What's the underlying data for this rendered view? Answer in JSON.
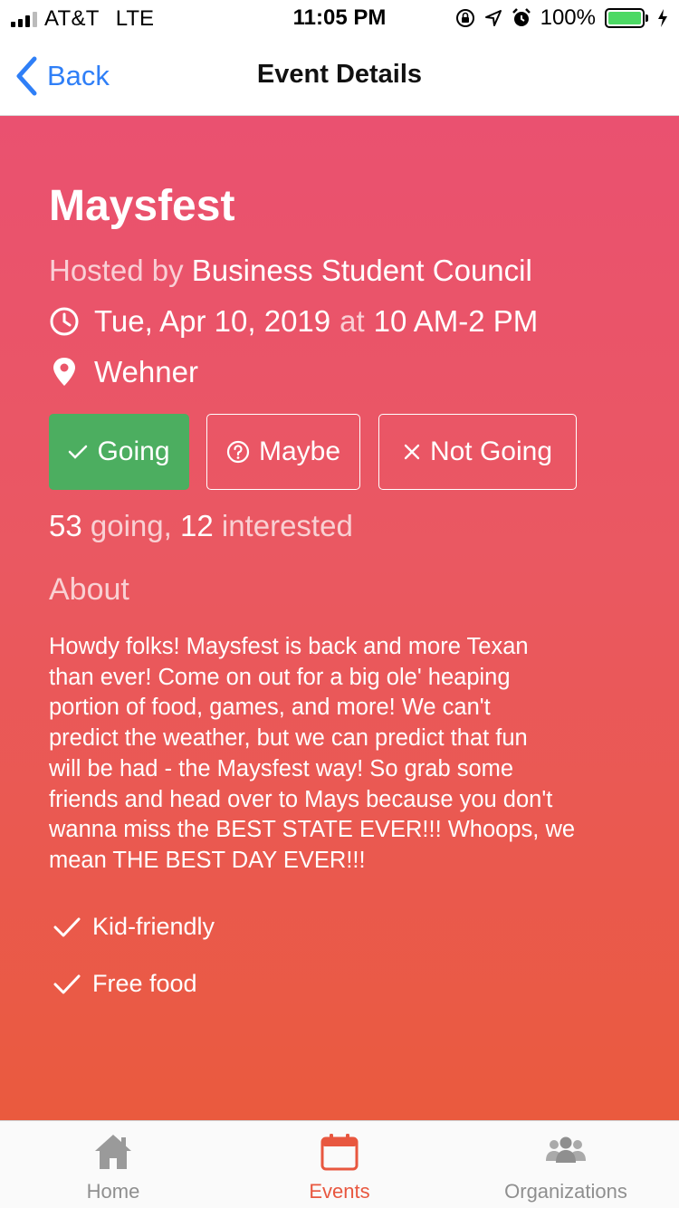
{
  "status_bar": {
    "carrier": "AT&T",
    "network": "LTE",
    "time": "11:05 PM",
    "battery": "100%",
    "battery_color": "#4cd964"
  },
  "nav": {
    "back_label": "Back",
    "title": "Event Details",
    "accent_color": "#2f7ff7"
  },
  "event": {
    "title": "Maysfest",
    "hosted_by_prefix": "Hosted by",
    "host": "Business Student Council",
    "date": "Tue, Apr 10, 2019",
    "at": "at",
    "time": "10 AM-2 PM",
    "location": "Wehner",
    "rsvp": {
      "going_label": "Going",
      "maybe_label": "Maybe",
      "not_going_label": "Not Going",
      "selected": "Going",
      "selected_color": "#4cae60"
    },
    "going_count": "53",
    "going_word": "going,",
    "interested_count": "12",
    "interested_word": "interested",
    "about_heading": "About",
    "about_text": "Howdy folks! Maysfest is back and more Texan\nthan ever!  Come on out for a big ole' heaping\nportion of food, games, and more! We can't\npredict the weather, but we can predict that fun\nwill be had - the Maysfest way! So grab some\nfriends and head over to Mays because you don't\nwanna miss the BEST STATE EVER!!! Whoops, we\nmean THE BEST DAY EVER!!!",
    "features": [
      "Kid-friendly",
      "Free food"
    ],
    "gradient": [
      "#ea5170",
      "#ea5a3e"
    ]
  },
  "tab_bar": {
    "active_tab": "Events",
    "active_color": "#e8573f",
    "tabs": [
      {
        "label": "Home",
        "icon": "home-icon"
      },
      {
        "label": "Events",
        "icon": "calendar-icon"
      },
      {
        "label": "Organizations",
        "icon": "people-icon"
      }
    ]
  }
}
